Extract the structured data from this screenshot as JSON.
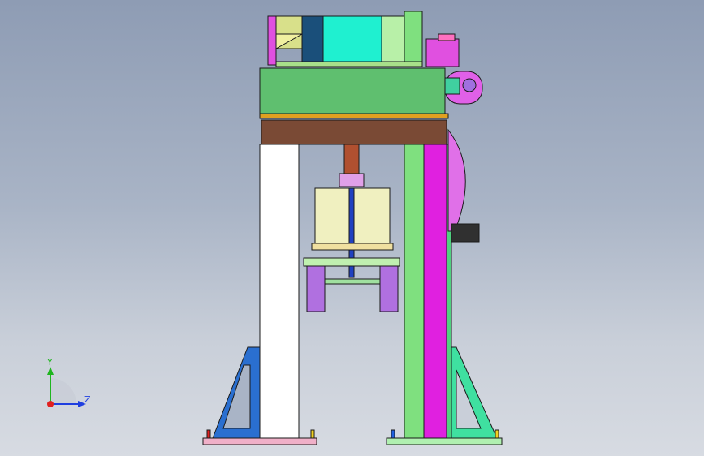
{
  "viewport": {
    "colors": {
      "bg_top": "#8e9cb4",
      "bg_bottom": "#d7dbe2",
      "outline": "#1a1a1a"
    }
  },
  "triad": {
    "y_label": "Y",
    "z_label": "Z",
    "y_color": "#1fb51f",
    "z_color": "#1f3fe0",
    "x_color": "#e02020"
  },
  "parts": {
    "frame_color": "#5fbf6f",
    "beam_color": "#7a4a35",
    "left_column_color": "#ffffff",
    "right_column_color": "#e020e0",
    "right_column_green": "#7fe07f",
    "left_brace_color": "#2a6fd0",
    "right_brace_color": "#3fe0a0",
    "motor_color": "#1ff0d0",
    "bracket_color": "#e050e0"
  }
}
